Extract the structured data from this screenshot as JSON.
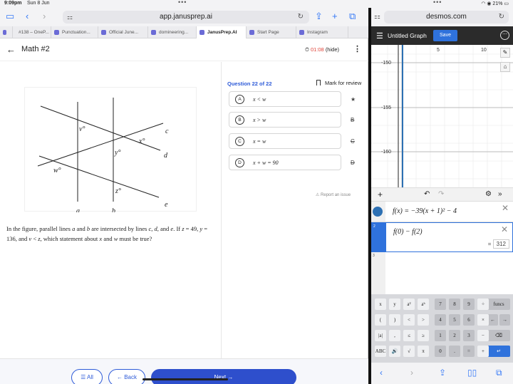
{
  "status": {
    "time": "9:09pm",
    "date": "Sun 8 Jun",
    "battery": "21%"
  },
  "left": {
    "url": "app.janusprep.ai",
    "tabs": [
      {
        "label": "",
        "w": 18
      },
      {
        "label": "#138 – OneP...",
        "w": 54
      },
      {
        "label": "Punctuation...",
        "w": 66
      },
      {
        "label": "Official June...",
        "w": 70
      },
      {
        "label": "domineering...",
        "w": 68
      },
      {
        "label": "JanusPrep.AI",
        "w": 70,
        "active": true
      },
      {
        "label": "Start Page",
        "w": 70
      },
      {
        "label": "Instagram",
        "w": 73
      }
    ],
    "header": {
      "title": "Math #2",
      "timer": "01:08",
      "hide": "(hide)"
    },
    "question": {
      "number": "Question 22 of 22",
      "mark": "Mark for review",
      "text_parts": [
        "In the figure, parallel lines ",
        "a",
        " and ",
        "b",
        " are intersected by lines ",
        "c",
        ", ",
        "d",
        ", and ",
        "e",
        ". If ",
        "z",
        " = 49, ",
        "y",
        " = 136, and ",
        "v",
        " < ",
        "z",
        ", which statement about ",
        "x",
        " and ",
        "w",
        " must be true?"
      ],
      "choices": [
        {
          "letter": "A",
          "text": "x < w",
          "strike": "★"
        },
        {
          "letter": "B",
          "text": "x > w",
          "strike": "B"
        },
        {
          "letter": "C",
          "text": "x = w",
          "strike": "C"
        },
        {
          "letter": "D",
          "text": "x + w = 90",
          "strike": "D"
        }
      ],
      "report": "Report an issue"
    },
    "figure": {
      "labels": [
        "v°",
        "x°",
        "y°",
        "w°",
        "z°",
        "c",
        "d",
        "e",
        "a",
        "b"
      ]
    },
    "buttons": {
      "all": "All",
      "back": "Back",
      "next": "Next"
    }
  },
  "right": {
    "url": "desmos.com",
    "title": "Untitled Graph",
    "save": "Save",
    "axis": {
      "x_ticks": [
        "5",
        "10"
      ],
      "y_ticks": [
        "-150",
        "-155",
        "-160"
      ]
    },
    "expressions": [
      {
        "num": "1",
        "text": "f(x) = −39(x + 1)² − 4"
      },
      {
        "num": "2",
        "text": "f(0) − f(2)",
        "result": "312"
      },
      {
        "num": "3",
        "text": ""
      }
    ],
    "keys": [
      [
        "x",
        "y",
        "a²",
        "aᵇ",
        "7",
        "8",
        "9",
        "÷"
      ],
      [
        "(",
        ")",
        "<",
        ">",
        "4",
        "5",
        "6",
        "×"
      ],
      [
        "|a|",
        ",",
        "≤",
        "≥",
        "1",
        "2",
        "3",
        "−"
      ],
      [
        "ABC",
        "🔊",
        "√",
        "π",
        "0",
        ".",
        "=",
        "+"
      ]
    ],
    "funcs": "funcs"
  }
}
